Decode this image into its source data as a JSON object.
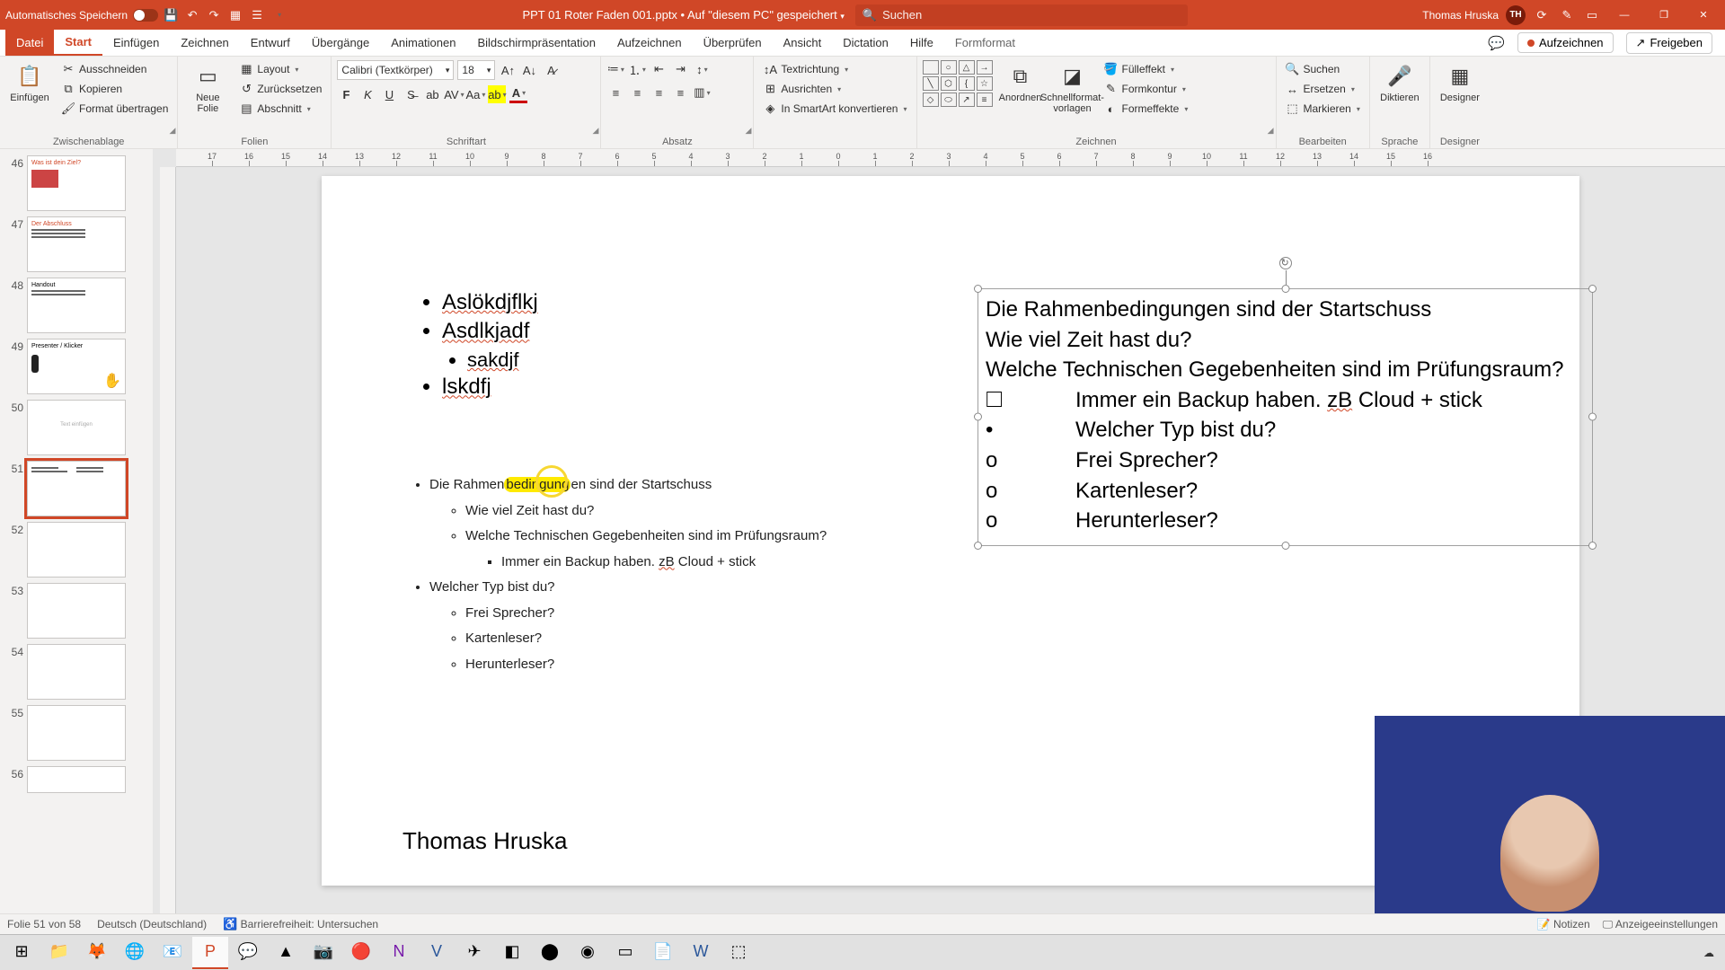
{
  "titlebar": {
    "autosave_label": "Automatisches Speichern",
    "doc_name": "PPT 01 Roter Faden 001.pptx",
    "saved_text": "Auf \"diesem PC\" gespeichert",
    "search_placeholder": "Suchen",
    "user_name": "Thomas Hruska",
    "user_initials": "TH"
  },
  "tabs": {
    "file": "Datei",
    "items": [
      "Start",
      "Einfügen",
      "Zeichnen",
      "Entwurf",
      "Übergänge",
      "Animationen",
      "Bildschirmpräsentation",
      "Aufzeichnen",
      "Überprüfen",
      "Ansicht",
      "Dictation",
      "Hilfe",
      "Formformat"
    ],
    "active": "Start",
    "record": "Aufzeichnen",
    "share": "Freigeben"
  },
  "ribbon": {
    "clipboard": {
      "paste": "Einfügen",
      "cut": "Ausschneiden",
      "copy": "Kopieren",
      "format_painter": "Format übertragen",
      "label": "Zwischenablage"
    },
    "slides": {
      "new_slide": "Neue\nFolie",
      "layout": "Layout",
      "reset": "Zurücksetzen",
      "section": "Abschnitt",
      "label": "Folien"
    },
    "font": {
      "name": "Calibri (Textkörper)",
      "size": "18",
      "label": "Schriftart"
    },
    "paragraph": {
      "label": "Absatz"
    },
    "textdir": {
      "textdir": "Textrichtung",
      "align": "Ausrichten",
      "smartart": "In SmartArt konvertieren"
    },
    "drawing": {
      "arrange": "Anordnen",
      "quick": "Schnellformat-\nvorlagen",
      "fill": "Fülleffekt",
      "outline": "Formkontur",
      "effects": "Formeffekte",
      "label": "Zeichnen"
    },
    "editing": {
      "find": "Suchen",
      "replace": "Ersetzen",
      "select": "Markieren",
      "label": "Bearbeiten"
    },
    "voice": {
      "dictate": "Diktieren",
      "label": "Sprache"
    },
    "designer": {
      "designer": "Designer",
      "label": "Designer"
    }
  },
  "thumbs": {
    "numbers": [
      "46",
      "47",
      "48",
      "49",
      "50",
      "51",
      "52",
      "53",
      "54",
      "55",
      "56"
    ],
    "active": "51"
  },
  "slide": {
    "box1": {
      "l1": "Aslökdjflkj",
      "l2": "Asdlkjadf",
      "l3": "sakdjf",
      "l4": "lskdfj"
    },
    "outline": {
      "i1": "Die Rahmenbedingungen sind der Startschuss",
      "i1a": "Wie viel Zeit hast du?",
      "i1b": "Welche Technischen Gegebenheiten sind im Prüfungsraum?",
      "i1b1": "Immer ein Backup haben. zB Cloud + stick",
      "i2": "Welcher Typ bist du?",
      "i2a": "Frei Sprecher?",
      "i2b": "Kartenleser?",
      "i2c": "Herunterleser?"
    },
    "selbox": {
      "l1": "Die Rahmenbedingungen sind der Startschuss",
      "l2": "Wie viel Zeit hast du?",
      "l3": "Welche Technischen Gegebenheiten sind im Prüfungsraum?",
      "b4": "🞎",
      "l4": "Immer ein Backup haben. zB Cloud + stick",
      "b5": "•",
      "l5": "Welcher Typ bist du?",
      "b6": "o",
      "l6": "Frei Sprecher?",
      "b7": "o",
      "l7": "Kartenleser?",
      "b8": "o",
      "l8": "Herunterleser?"
    },
    "author": "Thomas Hruska"
  },
  "statusbar": {
    "slide_info": "Folie 51 von 58",
    "language": "Deutsch (Deutschland)",
    "accessibility": "Barrierefreiheit: Untersuchen",
    "notes": "Notizen",
    "display": "Anzeigeeinstellungen"
  },
  "ruler_labels": [
    "17",
    "16",
    "15",
    "14",
    "13",
    "12",
    "11",
    "10",
    "9",
    "8",
    "7",
    "6",
    "5",
    "4",
    "3",
    "2",
    "1",
    "0",
    "1",
    "2",
    "3",
    "4",
    "5",
    "6",
    "7",
    "8",
    "9",
    "10",
    "11",
    "12",
    "13",
    "14",
    "15",
    "16"
  ]
}
